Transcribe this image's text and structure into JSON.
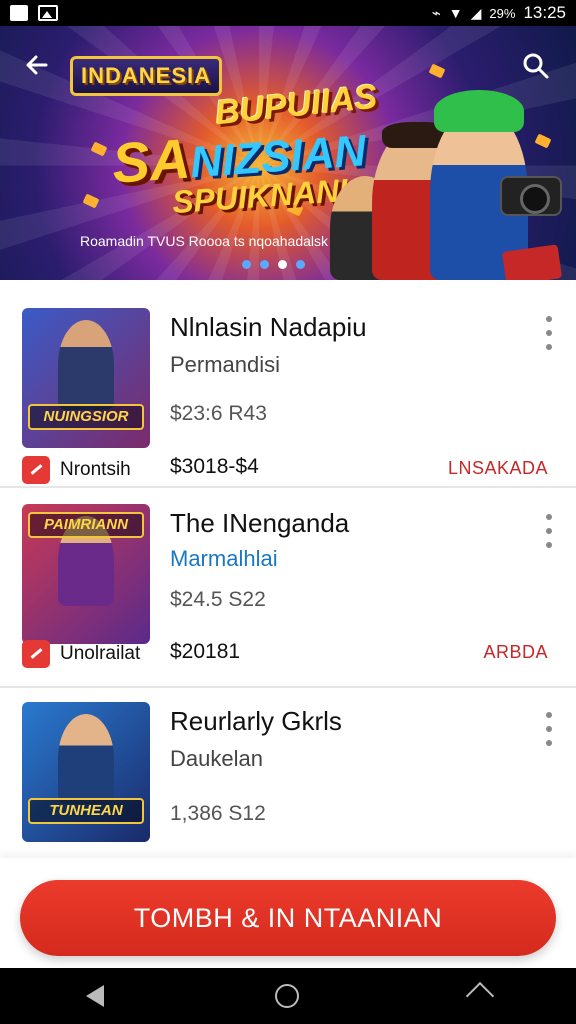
{
  "status_bar": {
    "battery": "29%",
    "time": "13:25"
  },
  "hero": {
    "logo_text": "INDANESIA",
    "title_line1": "BUPUIIAS",
    "title_line2a": "SA",
    "title_line2b": "NIZSIAN",
    "title_line3": "SPUIKNANI",
    "caption": "Roamadin  TVUS Roooa  ts nqoahadalsk",
    "carousel_count": 4,
    "carousel_active": 2
  },
  "games": [
    {
      "title": "Nlnlasin Nadapiu",
      "subtitle": "Permandisi",
      "price": "$23:6 R43",
      "price2": "$3018-$4",
      "badge_label": "Nrontsih",
      "tag": "LNSAKADA",
      "thumb_text": "NUINGSIOR",
      "thumb_colors": [
        "#3a5bc7",
        "#7c2a6a"
      ]
    },
    {
      "title": "The INenganda",
      "subtitle": "Marmalhlai",
      "price": "$24.5 S22",
      "price2": "$20181",
      "badge_label": "Unolrailat",
      "tag": "ARBDA",
      "thumb_text": "PAIMRIANN",
      "thumb_colors": [
        "#c93a55",
        "#5b2a8a"
      ]
    },
    {
      "title": "Reurlarly Gkrls",
      "subtitle": "Daukelan",
      "price": "1,386 S12",
      "price2": "",
      "badge_label": "",
      "tag": "",
      "thumb_text": "TUNHEAN",
      "thumb_colors": [
        "#2a7ad0",
        "#1a2a6a"
      ]
    }
  ],
  "cta": {
    "label": "TOMBH & IN NTAANIAN"
  },
  "colors": {
    "accent": "#e53935",
    "link": "#1a78c2"
  }
}
